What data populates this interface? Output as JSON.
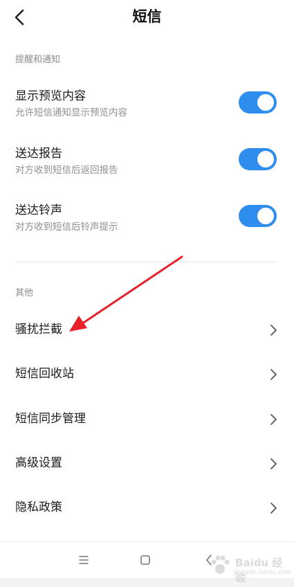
{
  "colors": {
    "accent": "#2f8ded",
    "text": "#1a1a1a",
    "subtext": "#8f8f8f",
    "annotation": "#e8202a"
  },
  "header": {
    "title": "短信"
  },
  "sections": [
    {
      "title": "提醒和通知"
    },
    {
      "title": "其他"
    }
  ],
  "toggles": [
    {
      "title": "显示预览内容",
      "subtitle": "允许短信通知显示预览内容",
      "on": true
    },
    {
      "title": "送达报告",
      "subtitle": "对方收到短信后返回报告",
      "on": true
    },
    {
      "title": "送达铃声",
      "subtitle": "对方收到短信后铃声提示",
      "on": true
    }
  ],
  "nav_items": [
    {
      "label": "骚扰拦截"
    },
    {
      "label": "短信回收站"
    },
    {
      "label": "短信同步管理"
    },
    {
      "label": "高级设置"
    },
    {
      "label": "隐私政策"
    }
  ],
  "watermark": {
    "text": "Baidu 经验",
    "sub": "jingyan.baidu.com"
  }
}
